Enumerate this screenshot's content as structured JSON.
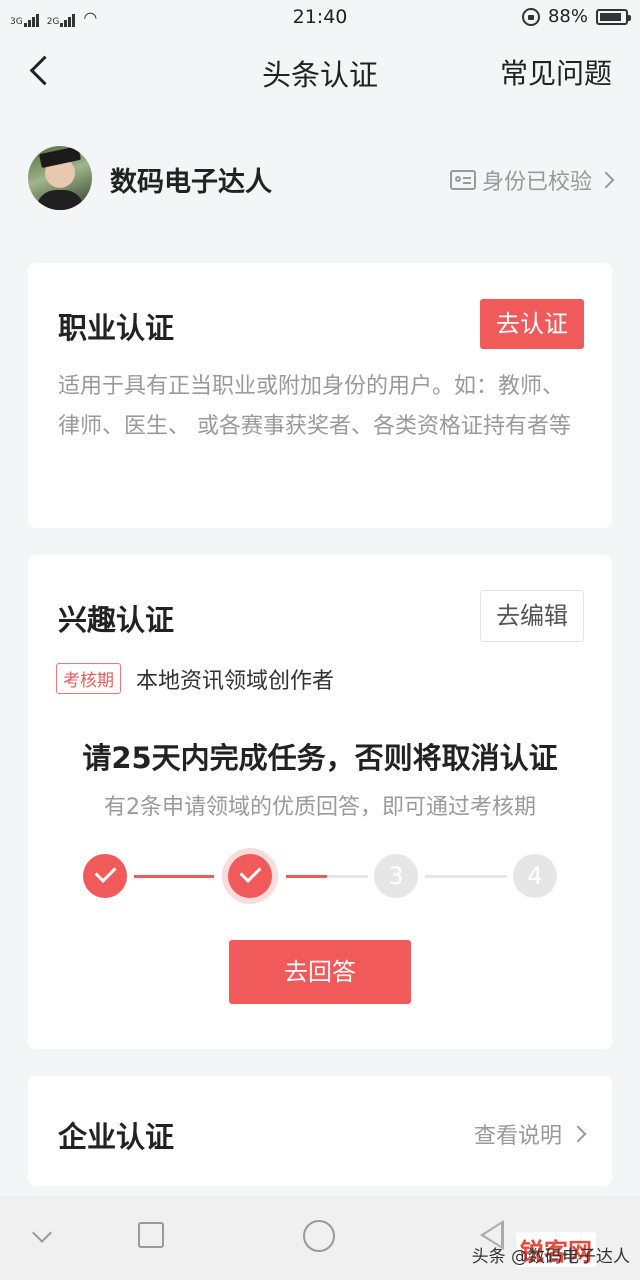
{
  "status_bar": {
    "sim1": "3G",
    "sim2": "2G",
    "time": "21:40",
    "battery": "88%",
    "battery_level": 0.88
  },
  "nav": {
    "title": "头条认证",
    "faq": "常见问题"
  },
  "user": {
    "name": "数码电子达人",
    "verify_status": "身份已校验"
  },
  "professional": {
    "title": "职业认证",
    "button": "去认证",
    "description": "适用于具有正当职业或附加身份的用户。如：教师、律师、医生、 或各赛事获奖者、各类资格证持有者等"
  },
  "interest": {
    "title": "兴趣认证",
    "button": "去编辑",
    "tag": "考核期",
    "field": "本地资讯领域创作者",
    "headline": "请25天内完成任务，否则将取消认证",
    "subtext": "有2条申请领域的优质回答，即可通过考核期",
    "steps": [
      "1",
      "2",
      "3",
      "4"
    ],
    "step_labels": [
      "3",
      "4"
    ],
    "completed_steps": 2,
    "connector_progress": [
      1.0,
      0.5,
      0.0
    ],
    "action": "去回答"
  },
  "enterprise": {
    "title": "企业认证",
    "link": "查看说明"
  },
  "watermark": {
    "text": "头条 @数码电子达人",
    "badge": "锐客网"
  },
  "colors": {
    "accent": "#f05a5a",
    "background": "#f4f5f6"
  }
}
